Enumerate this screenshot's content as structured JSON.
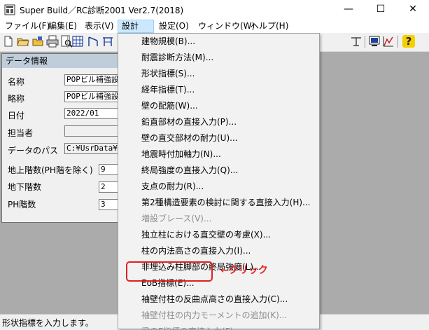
{
  "window": {
    "title": "Super Build／RC診断2001 Ver2.7(2018)",
    "minimize_glyph": "—",
    "maximize_glyph": "☐",
    "close_glyph": "✕"
  },
  "menubar": {
    "items": [
      "ファイル(F)",
      "編集(E)",
      "表示(V)",
      "設計(D)",
      "設定(O)",
      "ウィンドウ(W)",
      "ヘルプ(H)"
    ]
  },
  "toolbar": {
    "icons": [
      "new-file-icon",
      "open-folder-icon",
      "save-icon",
      "print-icon",
      "print-preview-icon",
      "building-icon",
      "structure-icon",
      "frame-icon",
      "wall-icon",
      "chart-window-icon",
      "graph-icon",
      "help-icon"
    ],
    "help_glyph": "?"
  },
  "data_window": {
    "title": "データ情報",
    "fields": [
      {
        "label": "名称",
        "value": "POPビル補強設"
      },
      {
        "label": "略称",
        "value": "POPビル補強設"
      },
      {
        "label": "日付",
        "value": "2022/01"
      },
      {
        "label": "担当者",
        "value": ""
      },
      {
        "label": "データのパス",
        "value": "C:¥UsrData¥S"
      }
    ],
    "floors": [
      {
        "label": "地上階数(PH階を除く)",
        "value": "9"
      },
      {
        "label": "地下階数",
        "value": "2"
      },
      {
        "label": "PH階数",
        "value": "3"
      }
    ]
  },
  "design_menu": {
    "items": [
      {
        "label": "建物規模(B)...",
        "enabled": true
      },
      {
        "label": "耐震診断方法(M)...",
        "enabled": true
      },
      {
        "label": "形状指標(S)...",
        "enabled": true
      },
      {
        "label": "経年指標(T)...",
        "enabled": true
      },
      {
        "label": "壁の配筋(W)...",
        "enabled": true
      },
      {
        "label": "鉛直部材の直接入力(P)...",
        "enabled": true
      },
      {
        "label": "壁の直交部材の耐力(U)...",
        "enabled": true
      },
      {
        "label": "地震時付加軸力(N)...",
        "enabled": true
      },
      {
        "label": "終局強度の直接入力(Q)...",
        "enabled": true
      },
      {
        "label": "支点の耐力(R)...",
        "enabled": true
      },
      {
        "label": "第2種構造要素の検討に関する直接入力(H)...",
        "enabled": true
      },
      {
        "label": "増設ブレース(V)...",
        "enabled": false
      },
      {
        "label": "独立柱における直交壁の考慮(X)...",
        "enabled": true
      },
      {
        "label": "柱の内法高さの直接入力(I)...",
        "enabled": true
      },
      {
        "label": "非埋込み柱脚部の終局強度(L)...",
        "enabled": true
      },
      {
        "label": "EoB指標(E)...",
        "enabled": true
      },
      {
        "label": "袖壁付柱の反曲点高さの直接入力(C)...",
        "enabled": true
      },
      {
        "label": "袖壁付柱の内力モーメントの追加(K)...",
        "enabled": false
      },
      {
        "label": "梁のF指標の直接入力(F)...",
        "enabled": false
      }
    ]
  },
  "annotation": {
    "text": "←クリック",
    "color": "#e02020"
  },
  "statusbar": {
    "text": "形状指標を入力します。"
  }
}
